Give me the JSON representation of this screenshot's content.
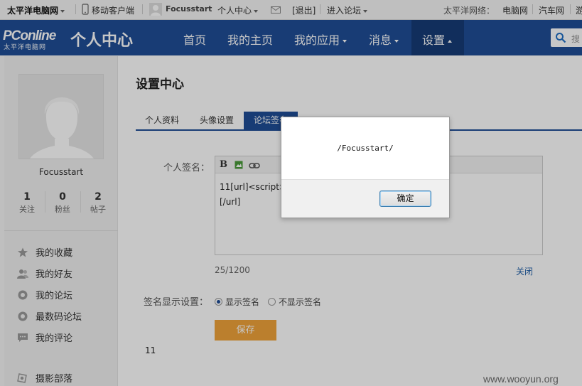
{
  "topbar": {
    "brand": "太平洋电脑网",
    "mobile_client": "移动客户端",
    "username": "Focusstart",
    "user_center": "个人中心",
    "logout": "[退出]",
    "forum": "进入论坛",
    "network_label": "太平洋网络：",
    "links": [
      "电脑网",
      "汽车网",
      "游"
    ]
  },
  "nav": {
    "logo_text": "PConline",
    "logo_cn": "太平洋电脑网",
    "title": "个人中心",
    "items": [
      "首页",
      "我的主页",
      "我的应用",
      "消息",
      "设置"
    ],
    "search_placeholder": "搜"
  },
  "sidebar": {
    "username": "Focusstart",
    "stats": [
      {
        "count": "1",
        "label": "关注"
      },
      {
        "count": "0",
        "label": "粉丝"
      },
      {
        "count": "2",
        "label": "帖子"
      }
    ],
    "menu": [
      "我的收藏",
      "我的好友",
      "我的论坛",
      "最数码论坛",
      "我的评论",
      "摄影部落"
    ],
    "menu_icons": [
      "star-icon",
      "friends-icon",
      "forum-icon",
      "digital-forum-icon",
      "comment-icon",
      "camera-icon"
    ]
  },
  "main": {
    "heading": "设置中心",
    "tabs": [
      "个人资料",
      "头像设置",
      "论坛签名"
    ],
    "signature_label": "个人签名：",
    "editor_line1": "11[url]<script>",
    "editor_line2": "[/url]",
    "counter": "25/1200",
    "close": "关闭",
    "display_label": "签名显示设置：",
    "radio_show": "显示签名",
    "radio_hide": "不显示签名",
    "save": "保存",
    "output": "11"
  },
  "dialog": {
    "message": "/Focusstart/",
    "ok": "确定"
  },
  "watermark": "www.wooyun.org",
  "colors": {
    "nav_blue": "#1f4e96",
    "save_orange": "#f0a33a"
  }
}
